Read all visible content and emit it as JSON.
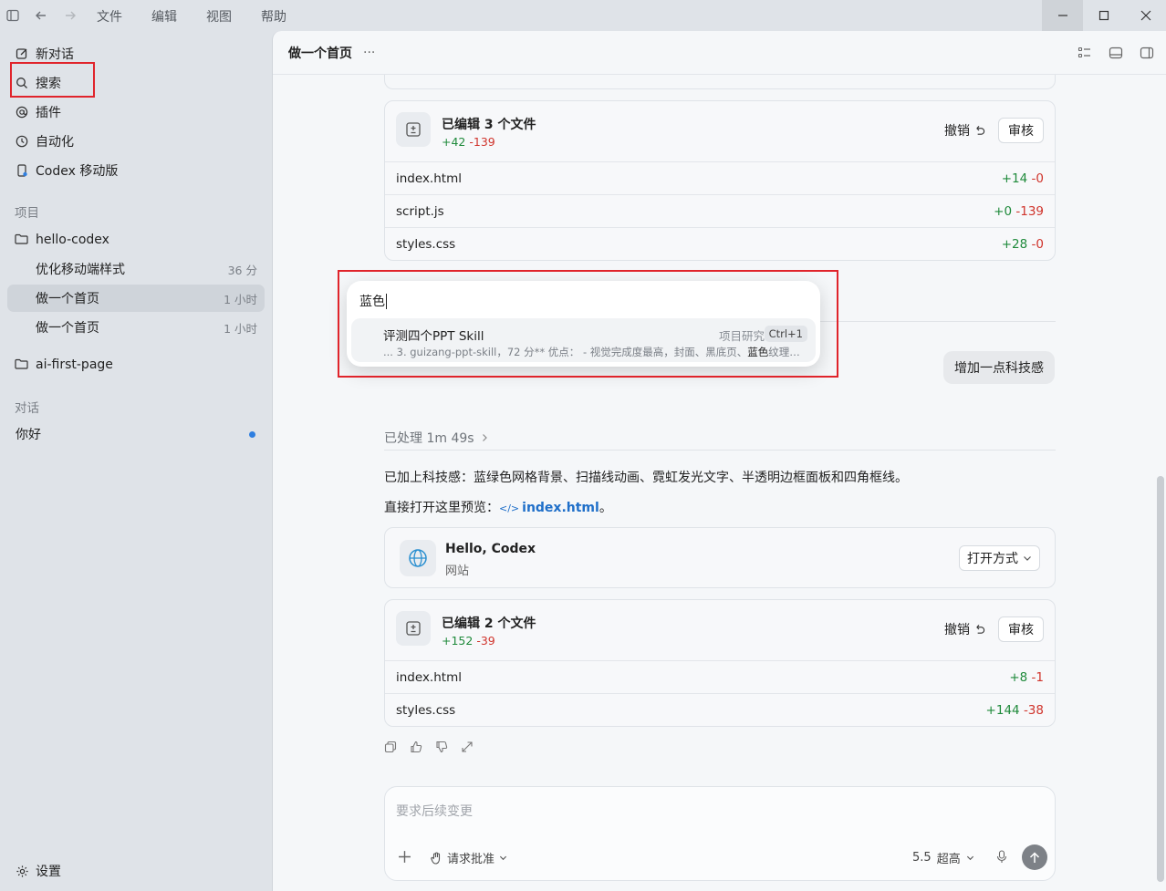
{
  "titlebar": {
    "menus": [
      "文件",
      "编辑",
      "视图",
      "帮助"
    ]
  },
  "sidebar": {
    "nav": [
      {
        "label": "新对话",
        "icon": "compose-icon"
      },
      {
        "label": "搜索",
        "icon": "search-icon"
      },
      {
        "label": "插件",
        "icon": "at-icon"
      },
      {
        "label": "自动化",
        "icon": "clock-icon"
      },
      {
        "label": "Codex 移动版",
        "icon": "phone-icon"
      }
    ],
    "projects_label": "项目",
    "projects": [
      {
        "name": "hello-codex",
        "threads": [
          {
            "title": "优化移动端样式",
            "time": "36 分"
          },
          {
            "title": "做一个首页",
            "time": "1 小时"
          },
          {
            "title": "做一个首页",
            "time": "1 小时"
          }
        ]
      },
      {
        "name": "ai-first-page",
        "threads": []
      }
    ],
    "chats_label": "对话",
    "chats": [
      {
        "title": "你好",
        "unread": true
      }
    ],
    "settings_label": "设置"
  },
  "header": {
    "title": "做一个首页",
    "more": "···"
  },
  "edit_card_1": {
    "title": "已编辑 3 个文件",
    "plus": "+42",
    "minus": "-139",
    "undo": "撤销",
    "review": "审核",
    "files": [
      {
        "name": "index.html",
        "plus": "+14",
        "minus": "-0"
      },
      {
        "name": "script.js",
        "plus": "+0",
        "minus": "-139"
      },
      {
        "name": "styles.css",
        "plus": "+28",
        "minus": "-0"
      }
    ]
  },
  "user_message": "增加一点科技感",
  "processed": "已处理 1m 49s",
  "reply": {
    "line1": "已加上科技感：蓝绿色网格背景、扫描线动画、霓虹发光文字、半透明边框面板和四角框线。",
    "line2_prefix": "直接打开这里预览：",
    "link_icon": "</>",
    "link": "index.html",
    "line2_suffix": "。"
  },
  "web_card": {
    "title": "Hello, Codex",
    "subtitle": "网站",
    "open_with": "打开方式"
  },
  "edit_card_2": {
    "title": "已编辑 2 个文件",
    "plus": "+152",
    "minus": "-39",
    "undo": "撤销",
    "review": "审核",
    "files": [
      {
        "name": "index.html",
        "plus": "+8",
        "minus": "-1"
      },
      {
        "name": "styles.css",
        "plus": "+144",
        "minus": "-38"
      }
    ]
  },
  "composer": {
    "placeholder": "要求后续变更",
    "approval": "请求批准",
    "model": "5.5",
    "effort": "超高"
  },
  "search": {
    "query": "蓝色",
    "result": {
      "title": "评测四个PPT Skill",
      "project": "项目研究",
      "shortcut": "Ctrl+1",
      "snippet_before": "... 3. guizang-ppt-skill，72 分** 优点： - 视觉完成度最高，封面、黑底页、",
      "snippet_highlight": "蓝色",
      "snippet_after": "纹理页..."
    }
  },
  "colors": {
    "plus": "#1f8a3b",
    "minus": "#d0342c",
    "link": "#1f6fc9",
    "highlight_box": "#e0242b",
    "unread_dot": "#2f7fe0"
  }
}
